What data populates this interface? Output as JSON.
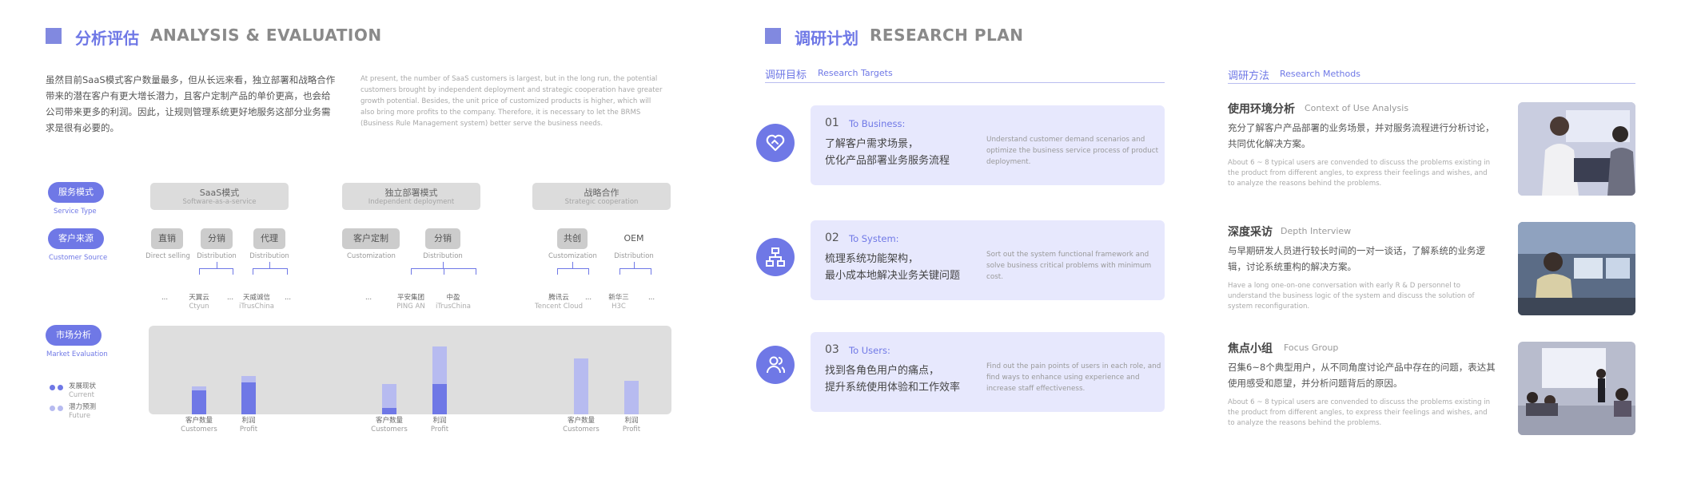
{
  "left": {
    "title_zh": "分析评估",
    "title_en": "ANALYSIS & EVALUATION",
    "intro_zh": "虽然目前SaaS模式客户数量最多，但从长远来看，独立部署和战略合作带来的潜在客户有更大增长潜力，且客户定制产品的单价更高，也会给公司带来更多的利润。因此，让规则管理系统更好地服务这部分业务需求是很有必要的。",
    "intro_en": "At present, the number of SaaS customers is largest, but in the long run, the potential customers brought by independent deployment and strategic cooperation have greater growth potential. Besides, the unit price of customized products is higher, which will also bring more profits to the company. Therefore, it is necessary to let the BRMS (Business Rule Management system) better serve the business needs.",
    "row_labels": [
      {
        "zh": "服务模式",
        "en": "Service Type"
      },
      {
        "zh": "客户来源",
        "en": "Customer Source"
      },
      {
        "zh": "市场分析",
        "en": "Market Evaluation"
      }
    ],
    "modes": [
      {
        "zh": "SaaS模式",
        "en": "Software-as-a-service"
      },
      {
        "zh": "独立部署模式",
        "en": "Independent deployment"
      },
      {
        "zh": "战略合作",
        "en": "Strategic cooperation"
      }
    ],
    "sources": [
      {
        "zh": "直销",
        "en": "Direct selling"
      },
      {
        "zh": "分销",
        "en": "Distribution"
      },
      {
        "zh": "代理",
        "en": "Distribution"
      },
      {
        "zh": "客户定制",
        "en": "Customization"
      },
      {
        "zh": "分销",
        "en": "Distribution"
      },
      {
        "zh": "共创",
        "en": "Customization"
      },
      {
        "zh": "OEM",
        "en": "Distribution"
      }
    ],
    "leaves": [
      {
        "zh": "...",
        "en": ""
      },
      {
        "zh": "天翼云",
        "en": "Ctyun"
      },
      {
        "zh": "...",
        "en": ""
      },
      {
        "zh": "天威诚信",
        "en": "iTrusChina"
      },
      {
        "zh": "...",
        "en": ""
      },
      {
        "zh": "...",
        "en": ""
      },
      {
        "zh": "平安集团",
        "en": "PING AN"
      },
      {
        "zh": "中盈",
        "en": "iTrusChina"
      },
      {
        "zh": "腾讯云",
        "en": "Tencent Cloud"
      },
      {
        "zh": "...",
        "en": ""
      },
      {
        "zh": "新华三",
        "en": "H3C"
      },
      {
        "zh": "...",
        "en": ""
      }
    ],
    "legend": [
      {
        "zh": "发展现状",
        "en": "Current",
        "color": "#6f78e6"
      },
      {
        "zh": "潜力预测",
        "en": "Future",
        "color": "#b7bbf0"
      }
    ]
  },
  "chart_data": {
    "type": "bar",
    "stacked": true,
    "title": "",
    "categories": [
      {
        "zh": "客户数量",
        "en": "Customers"
      },
      {
        "zh": "利润",
        "en": "Profit"
      },
      {
        "zh": "客户数量",
        "en": "Customers"
      },
      {
        "zh": "利润",
        "en": "Profit"
      },
      {
        "zh": "客户数量",
        "en": "Customers"
      },
      {
        "zh": "利润",
        "en": "Profit"
      }
    ],
    "series": [
      {
        "name": "发展现状",
        "color": "#6f78e6",
        "values": [
          30,
          40,
          8,
          38,
          0,
          0
        ]
      },
      {
        "name": "潜力预测",
        "color": "#b7bbf0",
        "values": [
          5,
          8,
          30,
          47,
          70,
          42
        ]
      }
    ],
    "ylim": [
      0,
      100
    ],
    "grid": false
  },
  "right": {
    "title_zh": "调研计划",
    "title_en": "RESEARCH PLAN",
    "targets_zh": "调研目标",
    "targets_en": "Research Targets",
    "methods_zh": "调研方法",
    "methods_en": "Research Methods",
    "targets": [
      {
        "num": "01",
        "to": "To Business:",
        "zh1": "了解客户需求场景，",
        "zh2": "优化产品部署业务服务流程",
        "en": "Understand customer demand scenarios and optimize the  business service process of product deployment.",
        "icon": "heart-handshake-icon"
      },
      {
        "num": "02",
        "to": "To System:",
        "zh1": "梳理系统功能架构，",
        "zh2": "最小成本地解决业务关键问题",
        "en": "Sort out the system functional framework and solve business critical problems with minimum cost.",
        "icon": "sitemap-icon"
      },
      {
        "num": "03",
        "to": "To Users:",
        "zh1": "找到各角色用户的痛点，",
        "zh2": "提升系统使用体验和工作效率",
        "en": "Find out the pain points of users in each role, and find ways to enhance  using experience and increase staff effectiveness.",
        "icon": "users-icon"
      }
    ],
    "methods": [
      {
        "zh": "使用环境分析",
        "en": "Context of Use Analysis",
        "dzh": "充分了解客户产品部署的业务场景，并对服务流程进行分析讨论，共同优化解决方案。",
        "den": "About 6 ~ 8 typical users are convended to discuss the problems existing in the product from different angles, to express their feelings and wishes, and to analyze the reasons behind the problems."
      },
      {
        "zh": "深度采访",
        "en": "Depth Interview",
        "dzh": "与早期研发人员进行较长时间的一对一谈话，了解系统的业务逻辑，讨论系统重构的解决方案。",
        "den": "Have a long one-on-one conversation with early R & D personnel to understand the business logic of the system and discuss the solution of system reconfiguration."
      },
      {
        "zh": "焦点小组",
        "en": "Focus Group",
        "dzh": "召集6~8个典型用户，从不同角度讨论产品中存在的问题，表达其使用感受和愿望，并分析问题背后的原因。",
        "den": "About 6 ~ 8 typical users are convended to discuss the problems existing in the product from different angles, to express their feelings and wishes, and to analyze the reasons behind the problems."
      }
    ]
  }
}
